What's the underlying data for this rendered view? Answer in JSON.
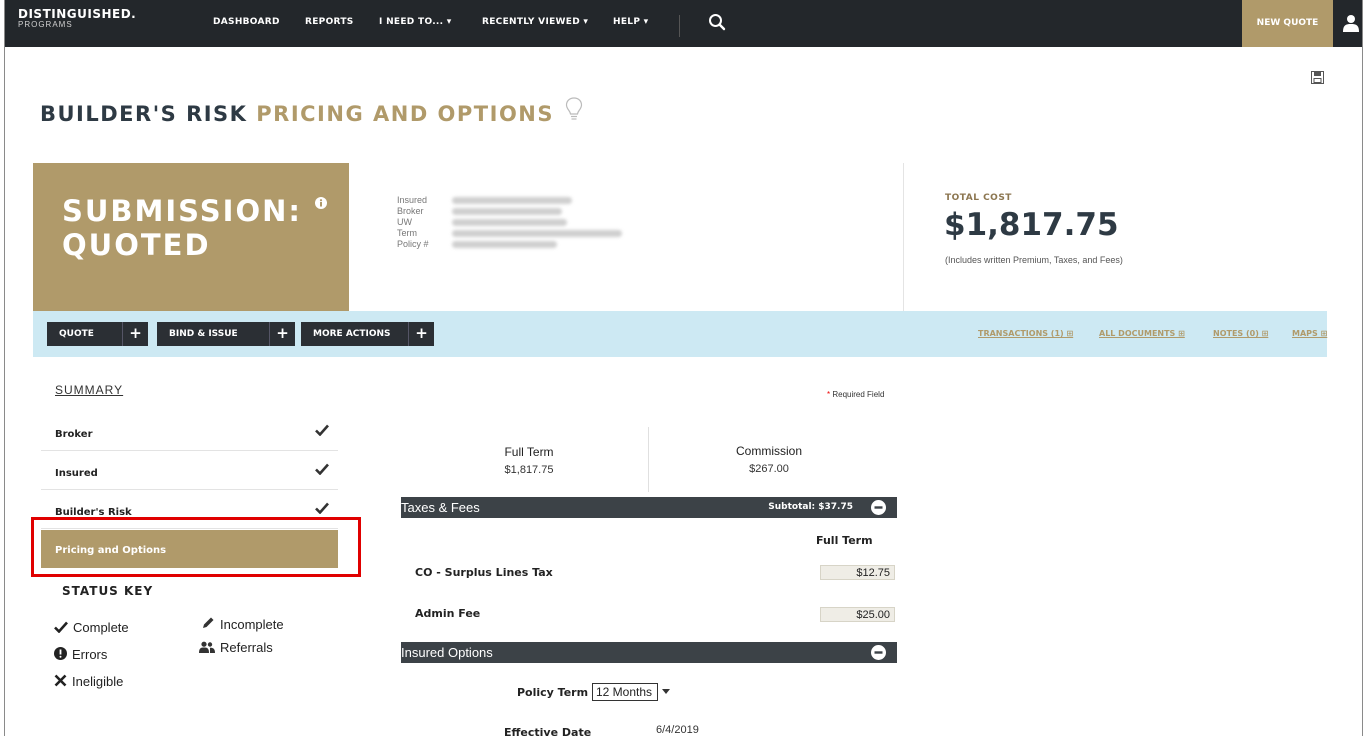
{
  "nav": {
    "brand_line1": "DISTINGUISHED.",
    "brand_line2": "PROGRAMS",
    "dashboard": "DASHBOARD",
    "reports": "REPORTS",
    "i_need_to": "I NEED TO... ▾",
    "recently_viewed": "RECENTLY VIEWED ▾",
    "help": "HELP ▾",
    "new_quote": "NEW QUOTE"
  },
  "header": {
    "title_part1": "BUILDER'S RISK",
    "title_part2": "PRICING AND OPTIONS"
  },
  "submission": {
    "status_line1": "SUBMISSION:",
    "status_line2": "QUOTED",
    "labels": [
      "Insured",
      "Broker",
      "UW",
      "Term",
      "Policy #"
    ]
  },
  "total_cost": {
    "label": "TOTAL COST",
    "value": "$1,817.75",
    "note": "(Includes written Premium, Taxes, and Fees)"
  },
  "actions": {
    "quote": "QUOTE",
    "bind_issue": "BIND & ISSUE",
    "more_actions": "MORE ACTIONS",
    "transactions": "TRANSACTIONS (1) ⊞",
    "all_documents": "ALL DOCUMENTS ⊞",
    "notes": "NOTES (0) ⊞",
    "maps": "MAPS ⊞"
  },
  "sidebar": {
    "summary": "SUMMARY",
    "items": [
      {
        "label": "Broker",
        "status": "complete"
      },
      {
        "label": "Insured",
        "status": "complete"
      },
      {
        "label": "Builder's Risk",
        "status": "complete"
      },
      {
        "label": "Pricing and Options",
        "status": "active"
      }
    ],
    "status_key_title": "STATUS KEY",
    "status_key": {
      "complete": "Complete",
      "incomplete": "Incomplete",
      "errors": "Errors",
      "referrals": "Referrals",
      "ineligible": "Ineligible"
    }
  },
  "main": {
    "required_field": "Required Field",
    "full_term_label": "Full Term",
    "full_term_value": "$1,817.75",
    "commission_label": "Commission",
    "commission_value": "$267.00",
    "taxes_fees": {
      "title": "Taxes & Fees",
      "subtotal": "Subtotal: $37.75",
      "column_header": "Full Term",
      "rows": [
        {
          "label": "CO - Surplus Lines Tax",
          "value": "$12.75"
        },
        {
          "label": "Admin Fee",
          "value": "$25.00"
        }
      ]
    },
    "insured_options": {
      "title": "Insured Options",
      "policy_term_label": "Policy Term",
      "policy_term_value": "12 Months",
      "effective_date_label": "Effective Date",
      "effective_date_value": "6/4/2019"
    }
  },
  "colors": {
    "gold": "#b09a6a",
    "dark": "#23272b",
    "action_bar": "#cde9f3",
    "section_bar": "#3c4247",
    "highlight": "#e00000"
  }
}
